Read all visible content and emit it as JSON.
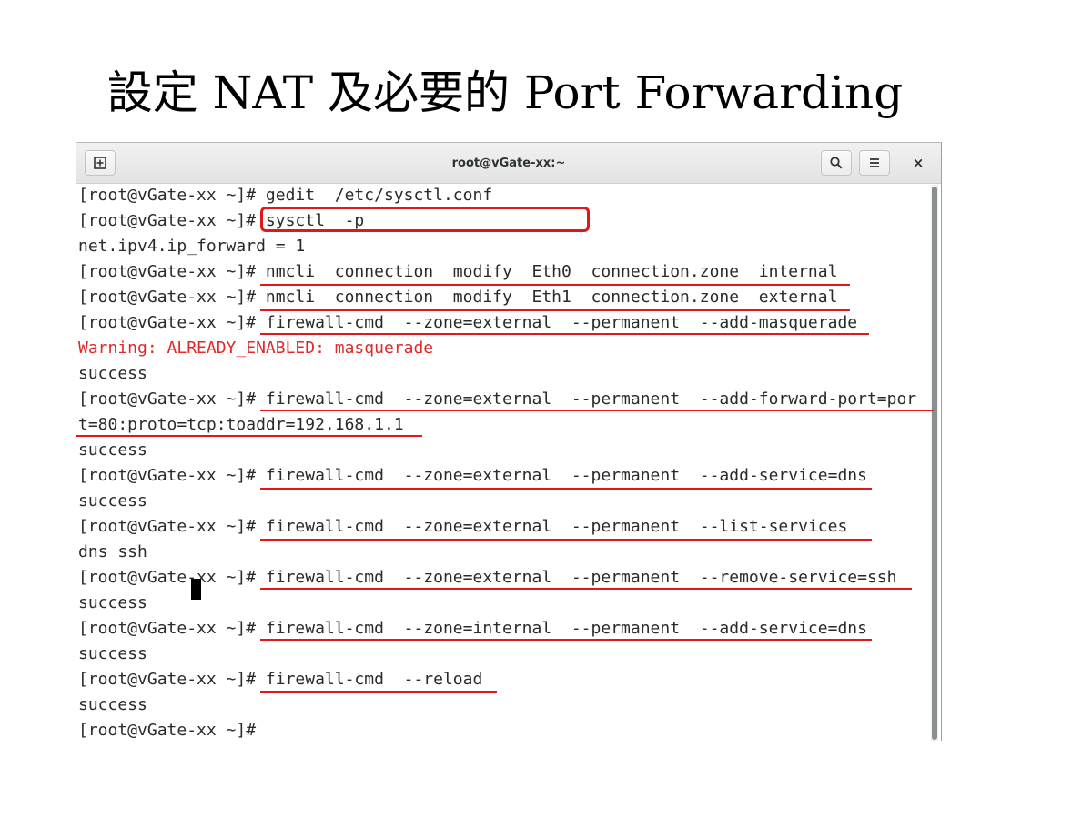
{
  "slide": {
    "title": "設定 NAT 及必要的 Port Forwarding"
  },
  "window": {
    "title": "root@vGate-xx:~",
    "buttons": {
      "new_tab_icon": "new-tab-icon",
      "search_icon": "search-icon",
      "menu_icon": "hamburger-menu-icon",
      "close_label": "×"
    }
  },
  "terminal": {
    "lines": [
      "[root@vGate-xx ~]# gedit  /etc/sysctl.conf",
      "[root@vGate-xx ~]# sysctl  -p",
      "net.ipv4.ip_forward = 1",
      "[root@vGate-xx ~]# nmcli  connection  modify  Eth0  connection.zone  internal",
      "[root@vGate-xx ~]# nmcli  connection  modify  Eth1  connection.zone  external",
      "[root@vGate-xx ~]# firewall-cmd  --zone=external  --permanent  --add-masquerade",
      "Warning: ALREADY_ENABLED: masquerade",
      "success",
      "[root@vGate-xx ~]# firewall-cmd  --zone=external  --permanent  --add-forward-port=por",
      "t=80:proto=tcp:toaddr=192.168.1.1",
      "success",
      "[root@vGate-xx ~]# firewall-cmd  --zone=external  --permanent  --add-service=dns",
      "success",
      "[root@vGate-xx ~]# firewall-cmd  --zone=external  --permanent  --list-services",
      "dns ssh",
      "[root@vGate-xx ~]# firewall-cmd  --zone=external  --permanent  --remove-service=ssh",
      "success",
      "[root@vGate-xx ~]# firewall-cmd  --zone=internal  --permanent  --add-service=dns",
      "success",
      "[root@vGate-xx ~]# firewall-cmd  --reload",
      "success",
      "[root@vGate-xx ~]# "
    ]
  },
  "colors": {
    "annotation": "#e01818",
    "warning_text": "#e02828",
    "terminal_text": "#2a2a2a"
  }
}
